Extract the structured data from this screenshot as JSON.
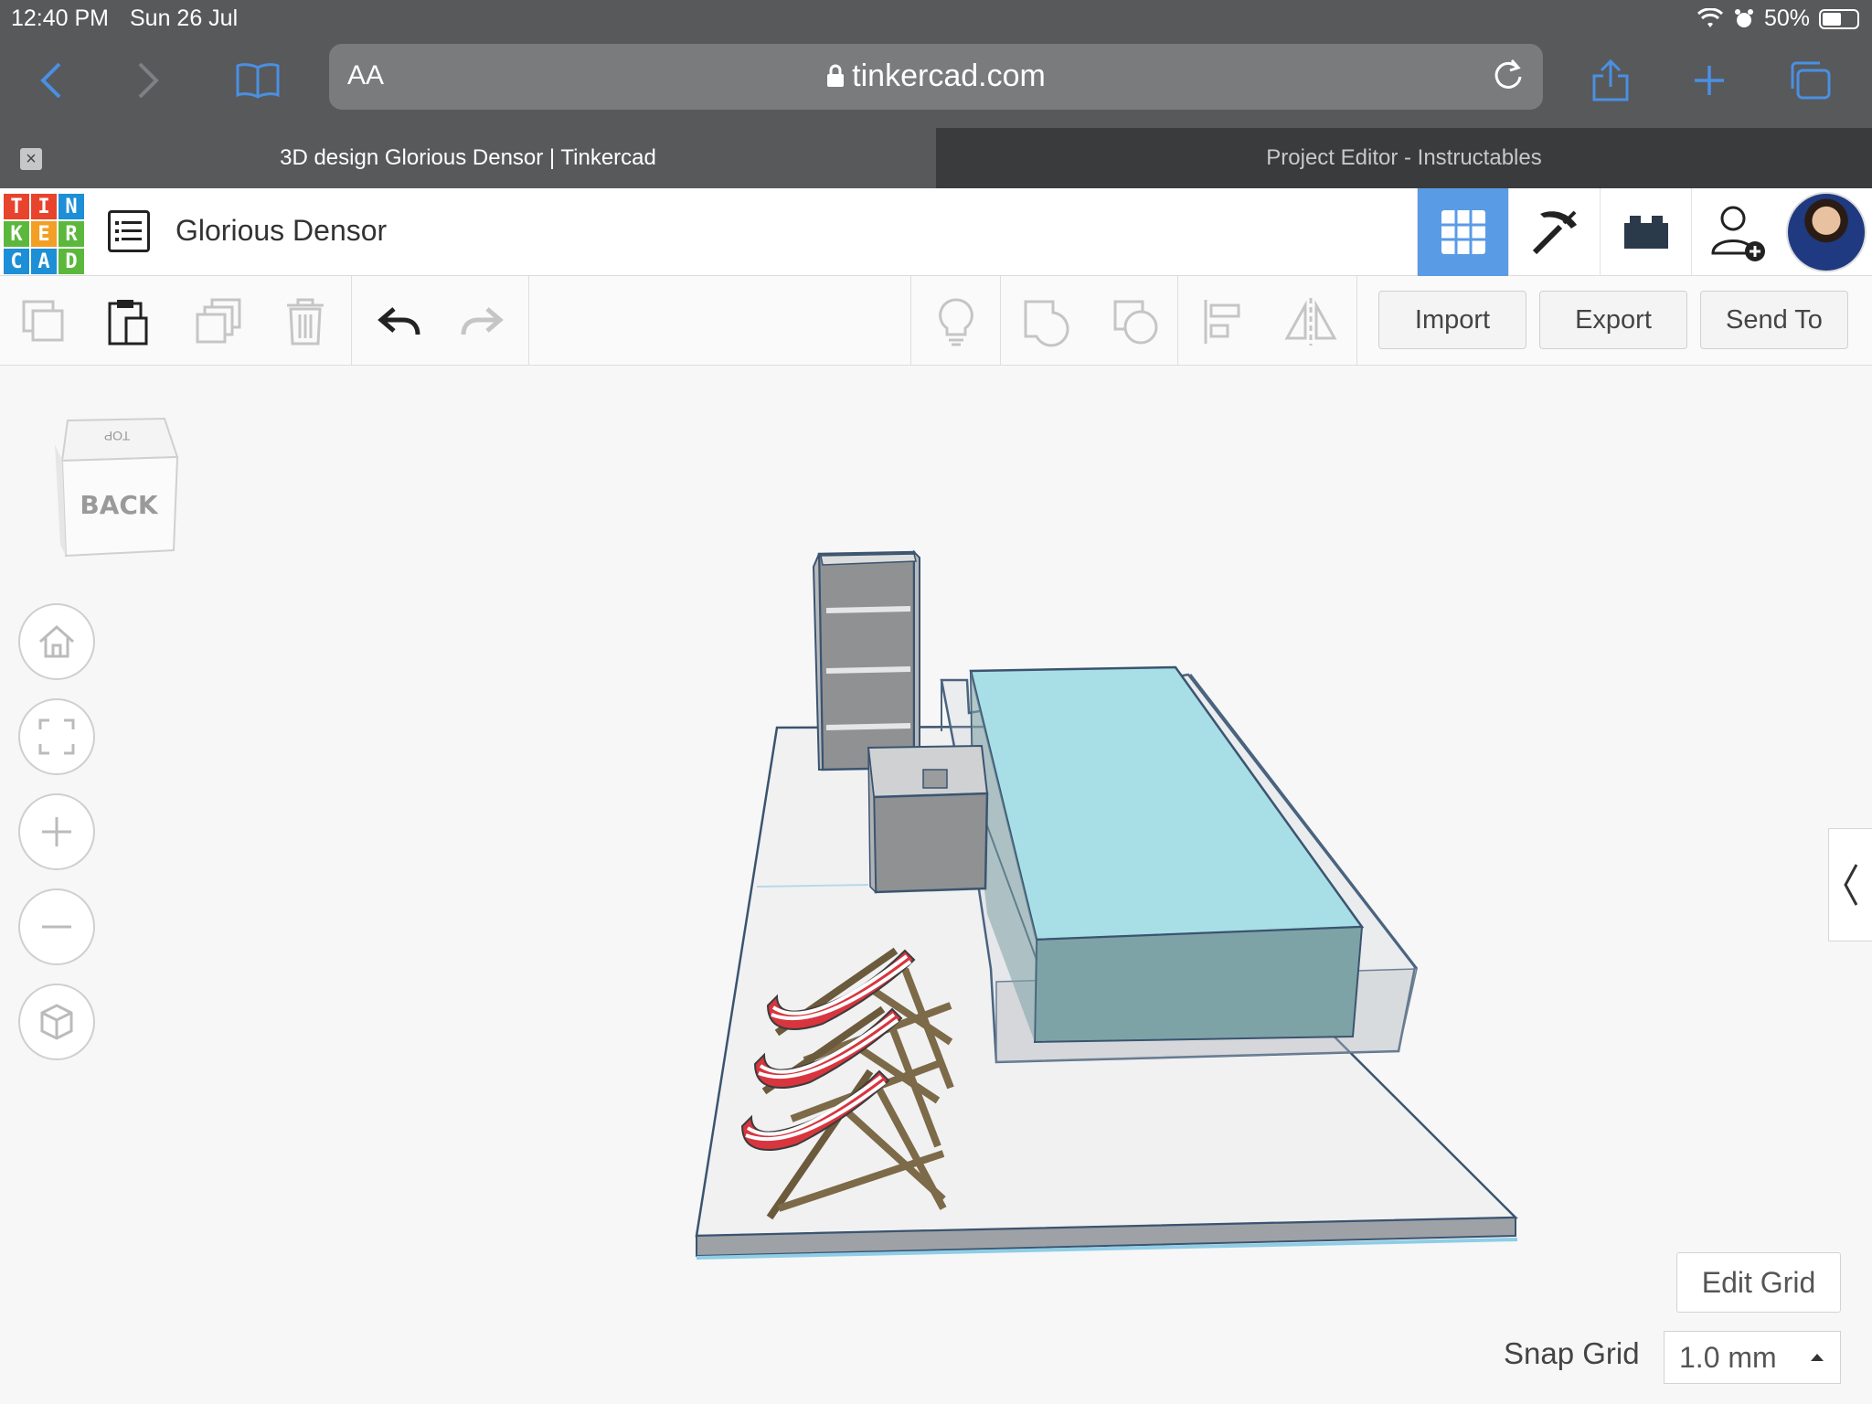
{
  "status_bar": {
    "time": "12:40 PM",
    "date": "Sun 26 Jul",
    "battery": "50%"
  },
  "browser": {
    "address_text_size": "AA",
    "url": "tinkercad.com",
    "tabs": [
      {
        "title": "3D design Glorious Densor | Tinkercad",
        "active": true
      },
      {
        "title": "Project Editor - Instructables",
        "active": false
      }
    ]
  },
  "app": {
    "logo_letters": [
      "T",
      "I",
      "N",
      "K",
      "E",
      "R",
      "C",
      "A",
      "D"
    ],
    "logo_colors": [
      "#e8432d",
      "#e8432d",
      "#1d8fd6",
      "#5cb83c",
      "#f29f24",
      "#5cb83c",
      "#1d8fd6",
      "#1d8fd6",
      "#5cb83c"
    ],
    "design_title": "Glorious Densor",
    "header_icons": [
      "3d-grid-icon",
      "pickaxe-icon",
      "brick-icon",
      "add-user-icon"
    ],
    "accent": "#5a9be6"
  },
  "edit_toolbar": {
    "import_label": "Import",
    "export_label": "Export",
    "send_to_label": "Send To"
  },
  "viewcube": {
    "top_label": "TOP",
    "front_label": "BACK"
  },
  "workplane": {
    "edit_grid_label": "Edit Grid",
    "snap_grid_label": "Snap Grid",
    "snap_grid_value": "1.0 mm"
  }
}
